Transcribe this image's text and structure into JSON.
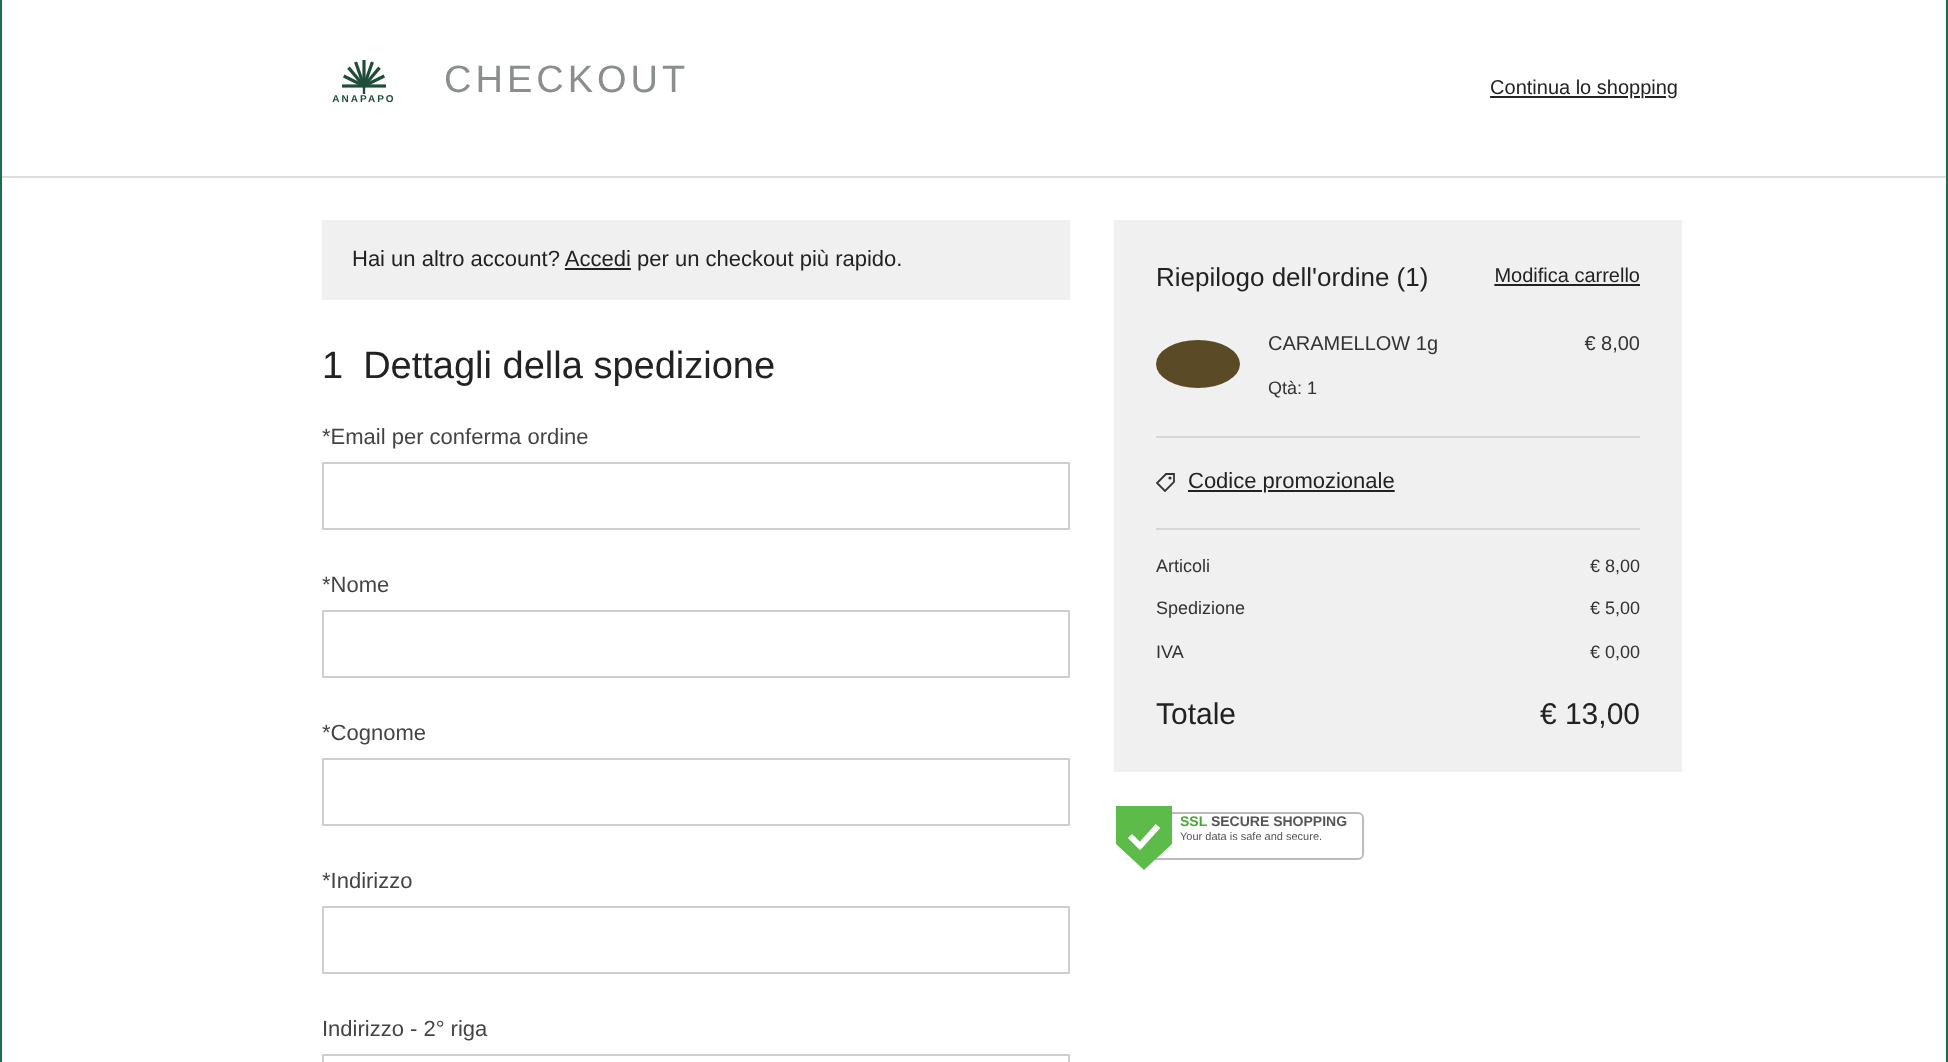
{
  "header": {
    "logo_text": "ANAPAPO",
    "title": "CHECKOUT",
    "continue_link": "Continua lo shopping"
  },
  "login_notice": {
    "before": "Hai un altro account?",
    "link": "Accedi",
    "after": "per un checkout più rapido."
  },
  "section": {
    "number": "1",
    "title": "Dettagli della spedizione"
  },
  "fields": [
    {
      "label": "*Email per conferma ordine"
    },
    {
      "label": "*Nome"
    },
    {
      "label": "*Cognome"
    },
    {
      "label": "*Indirizzo"
    },
    {
      "label": "Indirizzo - 2° riga"
    }
  ],
  "summary": {
    "title": "Riepilogo dell'ordine (1)",
    "edit_link": "Modifica carrello",
    "items": [
      {
        "name": "CARAMELLOW 1g",
        "quantity": "Qtà: 1",
        "price": "€ 8,00"
      }
    ],
    "promo_link": "Codice promozionale",
    "lines": [
      {
        "label": "Articoli",
        "value": "€ 8,00"
      },
      {
        "label": "Spedizione",
        "value": "€ 5,00"
      },
      {
        "label": "IVA",
        "value": "€ 0,00"
      }
    ],
    "total": {
      "label": "Totale",
      "value": "€ 13,00"
    }
  },
  "badge": {
    "title_a": "SSL",
    "title_b": "SECURE SHOPPING",
    "subtitle": "Your data is safe and secure."
  }
}
